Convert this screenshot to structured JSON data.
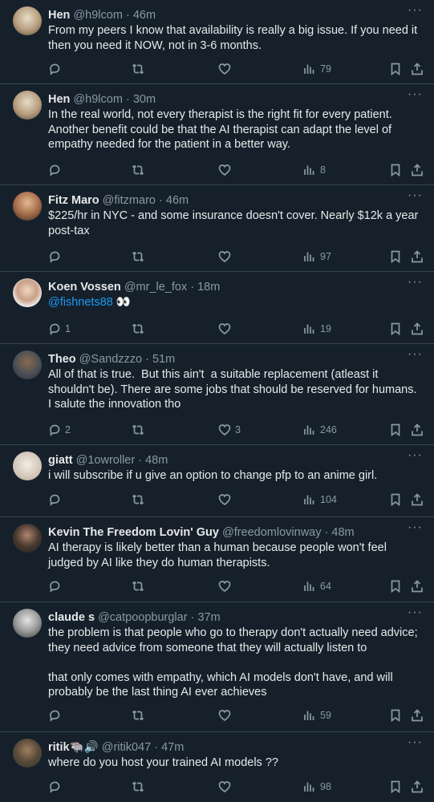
{
  "tweets": [
    {
      "name": "Hen",
      "handle": "@h9lcom",
      "time": "46m",
      "text": "From my peers I know that availability is really a big issue. If you need it then you need it NOW, not in 3-6 months.",
      "replies": "",
      "retweets": "",
      "likes": "",
      "views": "79",
      "avatar_color": "#c9b79c"
    },
    {
      "name": "Hen",
      "handle": "@h9lcom",
      "time": "30m",
      "text": "In the real world, not every therapist is the right fit for every patient. Another benefit could be that the AI therapist can adapt the level of empathy needed for the patient in a better way.",
      "replies": "",
      "retweets": "",
      "likes": "",
      "views": "8",
      "avatar_color": "#c9b79c"
    },
    {
      "name": "Fitz Maro",
      "handle": "@fitzmaro",
      "time": "46m",
      "text": "$225/hr in NYC - and some insurance doesn't cover. Nearly $12k a year post-tax",
      "replies": "",
      "retweets": "",
      "likes": "",
      "views": "97",
      "avatar_color": "#8a5a3c"
    },
    {
      "name": "Koen Vossen",
      "handle": "@mr_le_fox",
      "time": "18m",
      "mention": "@fishnets88",
      "emoji": "👀",
      "replies": "1",
      "retweets": "",
      "likes": "",
      "views": "19",
      "avatar_color": "#d8d2cc"
    },
    {
      "name": "Theo",
      "handle": "@Sandzzzo",
      "time": "51m",
      "text": "All of that is true.  But this ain't  a suitable replacement (atleast it shouldn't be). There are some jobs that should be reserved for humans.  I salute the innovation tho",
      "replies": "2",
      "retweets": "",
      "likes": "3",
      "views": "246",
      "avatar_color": "#3a3f46"
    },
    {
      "name": "giatt",
      "handle": "@1owroller",
      "time": "48m",
      "text": "i will subscribe if u give an option to change pfp to an anime girl.",
      "replies": "",
      "retweets": "",
      "likes": "",
      "views": "104",
      "avatar_color": "#e6e1dc"
    },
    {
      "name": "Kevin The Freedom Lovin' Guy",
      "handle": "@freedomlovinway",
      "time": "48m",
      "text": "AI therapy is likely better than a human because people won't feel judged by AI like they do human therapists.",
      "replies": "",
      "retweets": "",
      "likes": "",
      "views": "64",
      "avatar_color": "#2f2f2f"
    },
    {
      "name": "claude s",
      "handle": "@catpoopburglar",
      "time": "37m",
      "text": "the problem is that people who go to therapy don't actually need advice; they need advice from someone that they will actually listen to\n\nthat only comes with empathy, which AI models don't have, and will probably be the last thing AI ever achieves",
      "replies": "",
      "retweets": "",
      "likes": "",
      "views": "59",
      "avatar_color": "#9a9a9a"
    },
    {
      "name": "ritik",
      "name_emoji": "🐃🔊",
      "handle": "@ritik047",
      "time": "47m",
      "text": "where do you host your trained AI models ??",
      "replies": "",
      "retweets": "",
      "likes": "",
      "views": "98",
      "avatar_color": "#5a4a3a"
    }
  ],
  "dot": "·",
  "more_glyph": "···"
}
